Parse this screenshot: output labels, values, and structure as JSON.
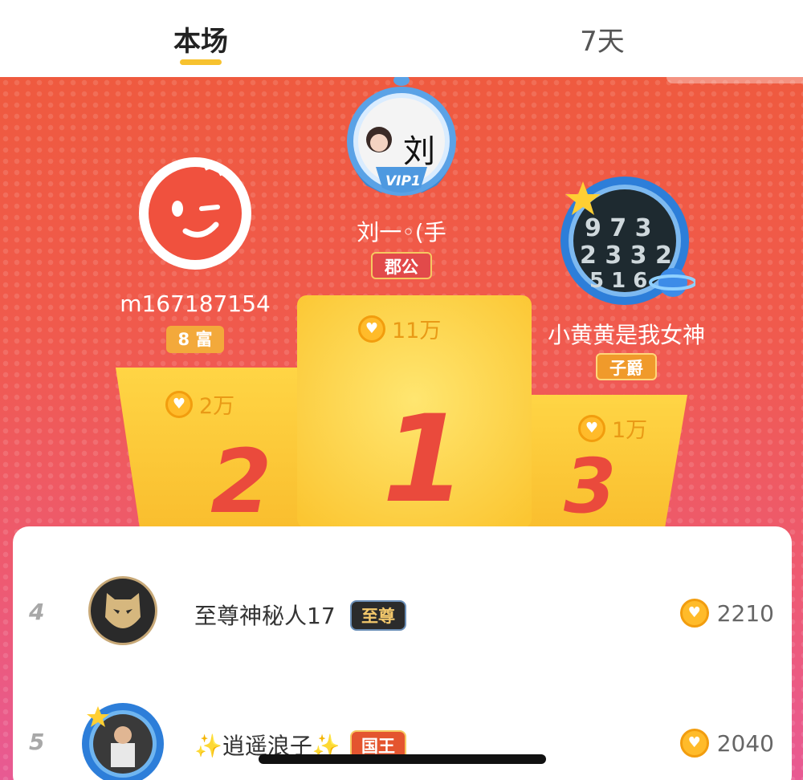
{
  "tabs": [
    {
      "label": "本场",
      "active": true
    },
    {
      "label": "7天",
      "active": false
    }
  ],
  "top3": [
    {
      "rank": "1",
      "name": "刘一◦(手",
      "badge": "郡公",
      "amount": "11万",
      "frame_badge": "VIP1",
      "avatar_char": "刘"
    },
    {
      "rank": "2",
      "name": "m167187154",
      "badge": "8 富",
      "amount": "2万"
    },
    {
      "rank": "3",
      "name": "小黄黄是我女神",
      "badge": "子爵",
      "amount": "1万"
    }
  ],
  "list": [
    {
      "rank": "4",
      "name": "至尊神秘人17",
      "level": "至尊",
      "score": "2210"
    },
    {
      "rank": "5",
      "name": "✨逍遥浪子✨",
      "level": "国王",
      "score": "2040"
    }
  ],
  "colors": {
    "accent": "#f7c22f",
    "rank_red": "#ea4a3c",
    "coin": "#ffbb2a"
  },
  "icons": {
    "coin": "heart-coin-icon",
    "star": "star-icon",
    "planet": "planet-icon"
  }
}
